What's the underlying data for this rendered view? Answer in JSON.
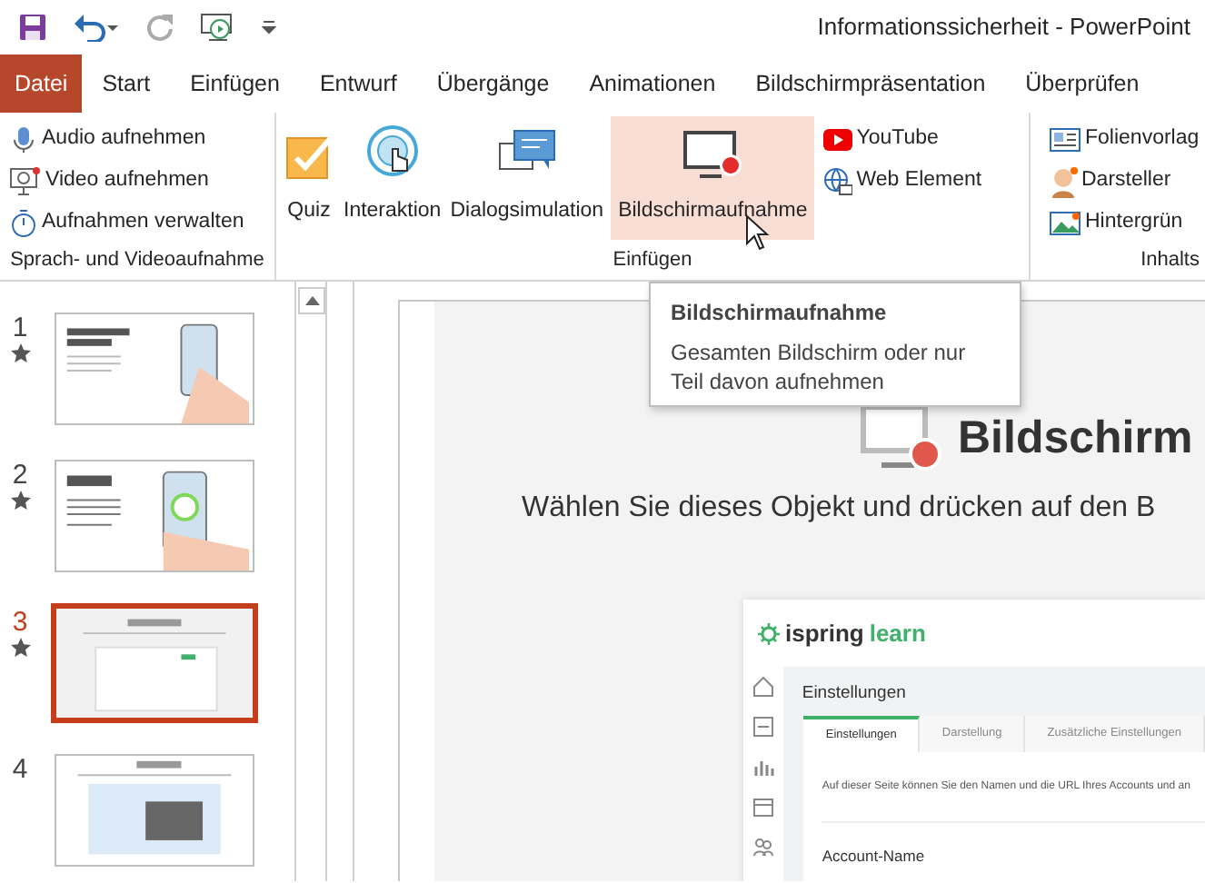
{
  "title_bar": {
    "title": "Informationssicherheit  -  PowerPoint"
  },
  "ribbon_tabs": [
    {
      "label": "Datei",
      "kind": "file"
    },
    {
      "label": "Start",
      "kind": "tab"
    },
    {
      "label": "Einfügen",
      "kind": "tab"
    },
    {
      "label": "Entwurf",
      "kind": "tab"
    },
    {
      "label": "Übergänge",
      "kind": "tab"
    },
    {
      "label": "Animationen",
      "kind": "tab"
    },
    {
      "label": "Bildschirmpräsentation",
      "kind": "tab"
    },
    {
      "label": "Überprüfen",
      "kind": "tab"
    }
  ],
  "ribbon_groups": [
    {
      "label": "Sprach- und Videoaufnahme",
      "items": [
        {
          "label": "Audio aufnehmen",
          "kind": "small"
        },
        {
          "label": "Video aufnehmen",
          "kind": "small"
        },
        {
          "label": "Aufnahmen verwalten",
          "kind": "small"
        }
      ]
    },
    {
      "label": "Einfügen",
      "items": [
        {
          "label": "Quiz",
          "kind": "large",
          "hovered": false
        },
        {
          "label": "Interaktion",
          "kind": "large",
          "hovered": false
        },
        {
          "label": "Dialogsimulation",
          "kind": "large",
          "hovered": false
        },
        {
          "label": "Bildschirmaufnahme",
          "kind": "large",
          "hovered": true
        },
        {
          "label": "YouTube",
          "kind": "small"
        },
        {
          "label": "Web Element",
          "kind": "small"
        }
      ]
    },
    {
      "label": "Inhalts",
      "items": [
        {
          "label": "Folienvorlag",
          "kind": "small"
        },
        {
          "label": "Darsteller",
          "kind": "small"
        },
        {
          "label": "Hintergrün",
          "kind": "small"
        }
      ]
    }
  ],
  "tooltip": {
    "title": "Bildschirmaufnahme",
    "text": "Gesamten Bildschirm oder nur Teil davon aufnehmen"
  },
  "slides": [
    {
      "number": "1",
      "selected": false,
      "animated": true
    },
    {
      "number": "2",
      "selected": false,
      "animated": true
    },
    {
      "number": "3",
      "selected": true,
      "animated": true
    },
    {
      "number": "4",
      "selected": false,
      "animated": false
    }
  ],
  "slide": {
    "title": "Bildschirm",
    "subtitle": "Wählen Sie dieses Objekt und drücken auf den B",
    "screenshot": {
      "logo_text": "ispring",
      "logo_accent": "learn",
      "heading": "Einstellungen",
      "tabs": [
        {
          "label": "Einstellungen",
          "selected": true
        },
        {
          "label": "Darstellung",
          "selected": false
        },
        {
          "label": "Zusätzliche Einstellungen",
          "selected": false
        }
      ],
      "description": "Auf dieser Seite können Sie den Namen und die URL Ihres Accounts und an",
      "section_title": "Account-Name"
    }
  }
}
